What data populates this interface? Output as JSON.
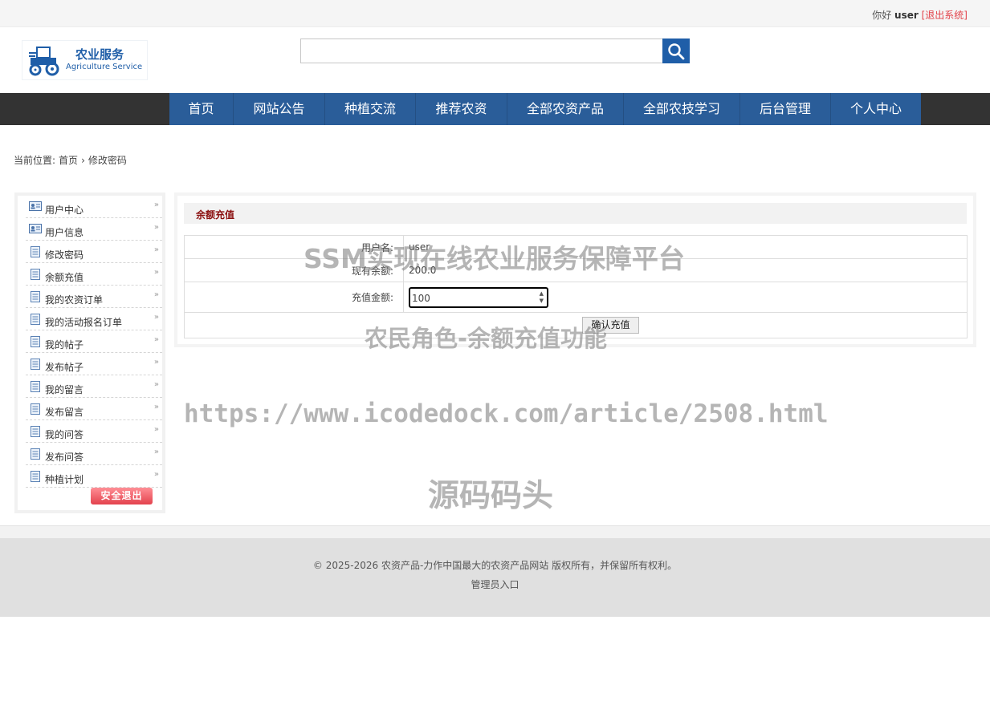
{
  "topbar": {
    "greeting": "你好",
    "username": "user",
    "logout": "[退出系统]"
  },
  "logo": {
    "cn": "农业服务",
    "en": "Agriculture Service"
  },
  "search": {
    "value": "",
    "placeholder": ""
  },
  "nav": [
    "首页",
    "网站公告",
    "种植交流",
    "推荐农资",
    "全部农资产品",
    "全部农技学习",
    "后台管理",
    "个人中心"
  ],
  "breadcrumb": {
    "prefix": "当前位置:",
    "home": "首页",
    "sep": "›",
    "current": "修改密码"
  },
  "sidebar": {
    "items": [
      {
        "label": "用户中心",
        "icon": "user-card-icon"
      },
      {
        "label": "用户信息",
        "icon": "user-card-icon"
      },
      {
        "label": "修改密码",
        "icon": "document-icon"
      },
      {
        "label": "余额充值",
        "icon": "document-icon"
      },
      {
        "label": "我的农资订单",
        "icon": "document-icon"
      },
      {
        "label": "我的活动报名订单",
        "icon": "document-icon"
      },
      {
        "label": "我的帖子",
        "icon": "document-icon"
      },
      {
        "label": "发布帖子",
        "icon": "document-icon"
      },
      {
        "label": "我的留言",
        "icon": "document-icon"
      },
      {
        "label": "发布留言",
        "icon": "document-icon"
      },
      {
        "label": "我的问答",
        "icon": "document-icon"
      },
      {
        "label": "发布问答",
        "icon": "document-icon"
      },
      {
        "label": "种植计划",
        "icon": "document-icon"
      }
    ],
    "arrow": "»",
    "logout_button": "安全退出"
  },
  "panel": {
    "title": "余额充值",
    "rows": {
      "username_label": "用户名:",
      "username_value": "user",
      "balance_label": "现有余额:",
      "balance_value": "200.0",
      "amount_label": "充值金额:",
      "amount_value": "100"
    },
    "submit": "确认充值"
  },
  "watermarks": {
    "line1": "SSM实现在线农业服务保障平台",
    "line2": "农民角色-余额充值功能",
    "line3": "https://www.icodedock.com/article/2508.html",
    "line4": "源码码头"
  },
  "footer": {
    "copyright": "© 2025-2026 农资产品-力作中国最大的农资产品网站 版权所有，并保留所有权利。",
    "admin_link": "管理员入口"
  },
  "colors": {
    "nav_blue": "#2a5d99",
    "brand_blue": "#1f5ea8",
    "logout_red": "#e2424a",
    "title_red": "#8b1010"
  }
}
